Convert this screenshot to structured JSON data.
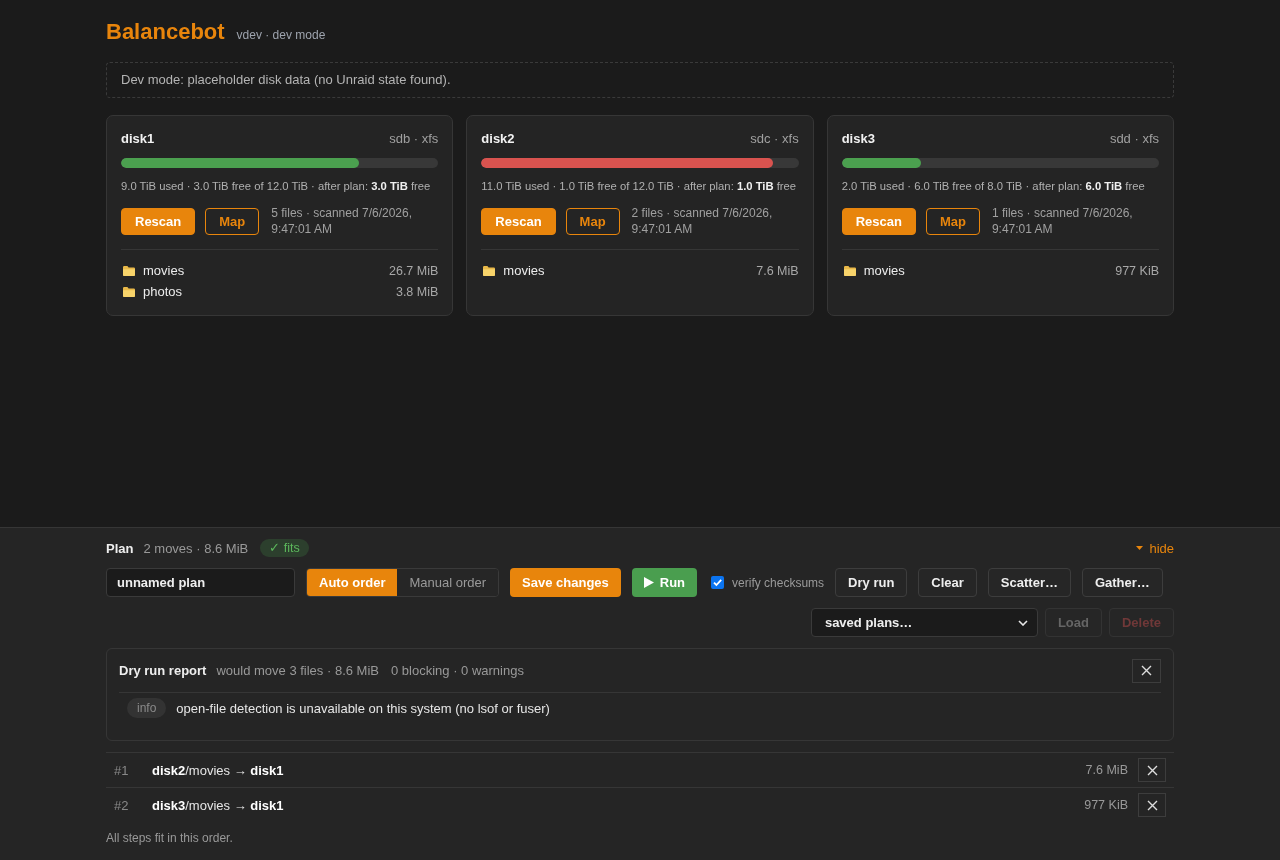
{
  "app": {
    "title": "Balancebot",
    "subtitle": "vdev · dev mode"
  },
  "notice": "Dev mode: placeholder disk data (no Unraid state found).",
  "disks": [
    {
      "name": "disk1",
      "device": "sdb · xfs",
      "level": 0.75,
      "color": "#4ba04f",
      "usage": "9.0 TiB used · 3.0 TiB free of 12.0 TiB · after plan: **3.0 TiB** free",
      "buttons": [
        {
          "label": "Rescan",
          "kind": "primary"
        },
        {
          "label": "Map",
          "kind": "outline"
        }
      ],
      "scan_info": "5 files · scanned 7/6/2026, 9:47:01 AM",
      "folders": [
        {
          "name": "movies",
          "size": "26.7 MiB"
        },
        {
          "name": "photos",
          "size": "3.8 MiB"
        }
      ]
    },
    {
      "name": "disk2",
      "device": "sdc · xfs",
      "level": 0.92,
      "color": "#d9534f",
      "usage": "11.0 TiB used · 1.0 TiB free of 12.0 TiB · after plan: **1.0 TiB** free",
      "buttons": [
        {
          "label": "Rescan",
          "kind": "primary"
        },
        {
          "label": "Map",
          "kind": "outline"
        }
      ],
      "scan_info": "2 files · scanned 7/6/2026, 9:47:01 AM",
      "folders": [
        {
          "name": "movies",
          "size": "7.6 MiB"
        }
      ]
    },
    {
      "name": "disk3",
      "device": "sdd · xfs",
      "level": 0.25,
      "color": "#4ba04f",
      "usage": "2.0 TiB used · 6.0 TiB free of 8.0 TiB · after plan: **6.0 TiB** free",
      "buttons": [
        {
          "label": "Rescan",
          "kind": "primary"
        },
        {
          "label": "Map",
          "kind": "outline"
        }
      ],
      "scan_info": "1 files · scanned 7/6/2026, 9:47:01 AM",
      "folders": [
        {
          "name": "movies",
          "size": "977 KiB"
        }
      ]
    }
  ],
  "plan": {
    "title": "Plan",
    "summary": "2 moves · 8.6 MiB",
    "status_badge": "✓ fits",
    "toggle": "hide",
    "name_field": {
      "value": "unnamed plan"
    },
    "order_modes": [
      {
        "label": "Auto order",
        "selected": true
      },
      {
        "label": "Manual order",
        "selected": false
      }
    ],
    "actions": [
      {
        "label": "Save changes",
        "kind": "primary"
      },
      {
        "label": "Run",
        "kind": "run"
      }
    ],
    "verify_checksums": {
      "label": "verify checksums",
      "checked": true
    },
    "tools": [
      "Dry run",
      "Clear",
      "Scatter…",
      "Gather…"
    ],
    "saved_plans": {
      "select": "saved plans…",
      "buttons": [
        {
          "label": "Load",
          "kind": "neutral",
          "disabled": true
        },
        {
          "label": "Delete",
          "kind": "danger",
          "disabled": true
        }
      ]
    }
  },
  "dry_run_report": {
    "title": "Dry run report",
    "summary": "would move 3 files · 8.6 MiB",
    "counts": "0 blocking · 0 warnings",
    "messages": [
      {
        "tag": "info",
        "text": "open-file detection is unavailable on this system (no lsof or fuser)"
      }
    ]
  },
  "moves": [
    {
      "index": "#1",
      "path": "**disk2**/movies → **disk1**",
      "size": "7.6 MiB"
    },
    {
      "index": "#2",
      "path": "**disk3**/movies → **disk1**",
      "size": "977 KiB"
    }
  ],
  "footer": "All steps fit in this order."
}
